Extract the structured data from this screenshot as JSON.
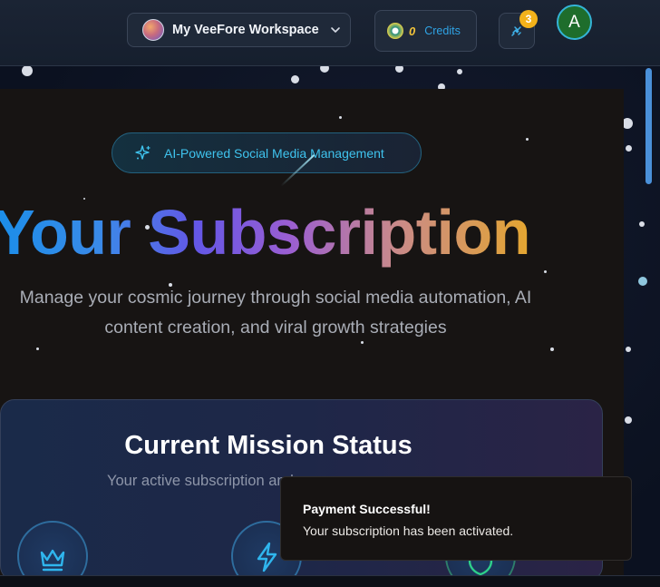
{
  "header": {
    "workspace_label": "My VeeFore Workspace",
    "credits_count": "0",
    "credits_label": "Credits",
    "notification_count": "3",
    "user_initial": "A"
  },
  "hero": {
    "badge_label": "AI-Powered Social Media Management",
    "title": "Your Subscription",
    "subtitle": "Manage your cosmic journey through social media automation, AI content creation, and viral growth strategies"
  },
  "mission": {
    "title": "Current Mission Status",
    "subtitle": "Your active subscription and usage"
  },
  "toast": {
    "title": "Payment Successful!",
    "description": "Your subscription has been activated."
  },
  "colors": {
    "accent_cyan": "#3fc3ee",
    "credits_blue": "#2fa4e6",
    "credit_count_yellow": "#f3c43a",
    "badge_orange": "#f3b21a",
    "avatar_green": "#1e6d2c"
  }
}
